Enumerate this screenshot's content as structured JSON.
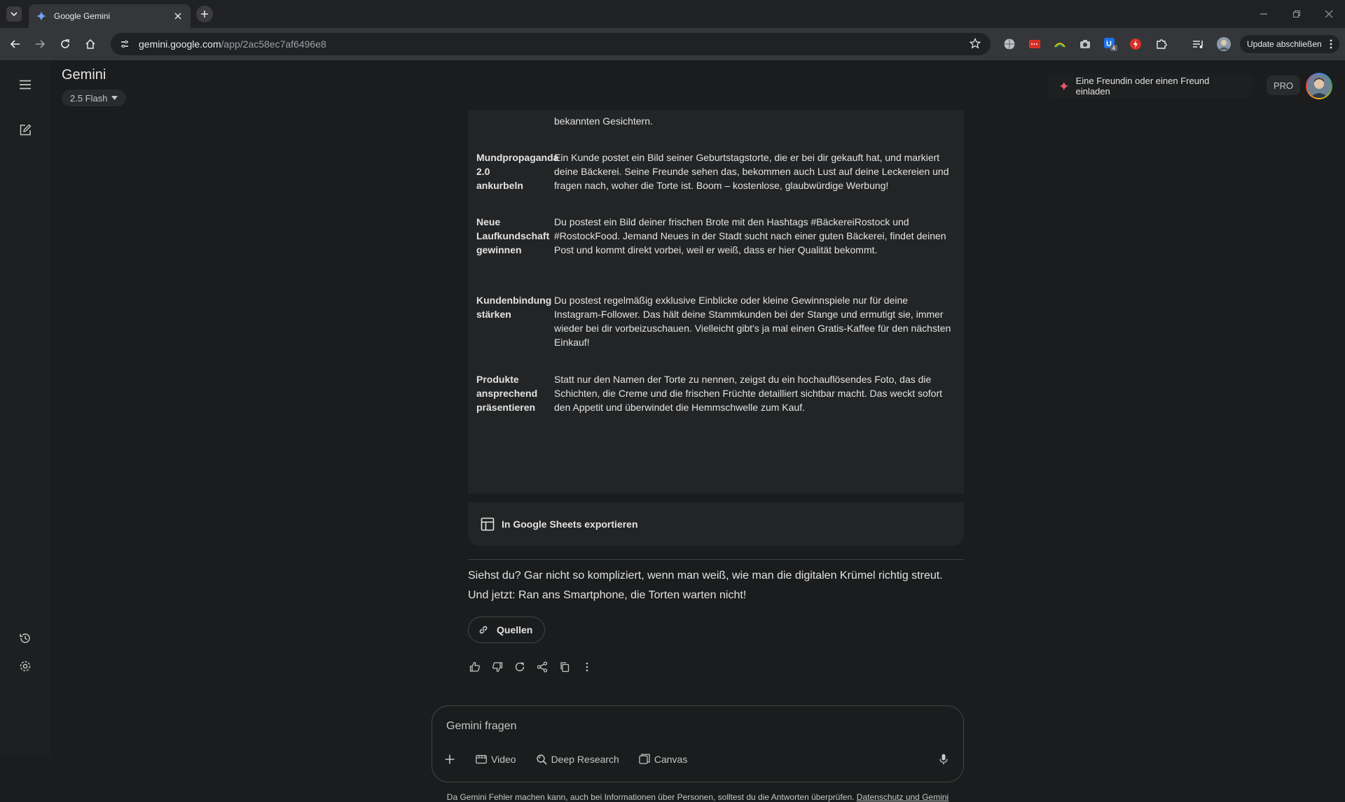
{
  "browser": {
    "tab_title": "Google Gemini",
    "url_host": "gemini.google.com",
    "url_path": "/app/2ac58ec7af6496e8",
    "update_label": "Update abschließen",
    "extension_badge": "4"
  },
  "header": {
    "app_title": "Gemini",
    "model_label": "2.5 Flash",
    "invite_label": "Eine Freundin oder einen Freund einladen",
    "pro_label": "PRO"
  },
  "table": {
    "partial_text": "bekannten Gesichtern.",
    "rows": [
      {
        "key": "Mundpropaganda 2.0 ankurbeln",
        "value": "Ein Kunde postet ein Bild seiner Geburtstagstorte, die er bei dir gekauft hat, und markiert deine Bäckerei. Seine Freunde sehen das, bekommen auch Lust auf deine Leckereien und fragen nach, woher die Torte ist. Boom – kostenlose, glaubwürdige Werbung!"
      },
      {
        "key": "Neue Laufkundschaft gewinnen",
        "value": "Du postest ein Bild deiner frischen Brote mit den Hashtags #BäckereiRostock und #RostockFood. Jemand Neues in der Stadt sucht nach einer guten Bäckerei, findet deinen Post und kommt direkt vorbei, weil er weiß, dass er hier Qualität bekommt."
      },
      {
        "key": "Kundenbindung stärken",
        "value": "Du postest regelmäßig exklusive Einblicke oder kleine Gewinnspiele nur für deine Instagram-Follower. Das hält deine Stammkunden bei der Stange und ermutigt sie, immer wieder bei dir vorbeizuschauen. Vielleicht gibt's ja mal einen Gratis-Kaffee für den nächsten Einkauf!"
      },
      {
        "key": "Produkte ansprechend präsentieren",
        "value": "Statt nur den Namen der Torte zu nennen, zeigst du ein hochauflösendes Foto, das die Schichten, die Creme und die frischen Früchte detailliert sichtbar macht. Das weckt sofort den Appetit und überwindet die Hemmschwelle zum Kauf."
      }
    ],
    "export_label": "In Google Sheets exportieren"
  },
  "response": {
    "closing_text": "Siehst du? Gar nicht so kompliziert, wenn man weiß, wie man die digitalen Krümel richtig streut. Und jetzt: Ran ans Smartphone, die Torten warten nicht!",
    "sources_label": "Quellen"
  },
  "input": {
    "placeholder": "Gemini fragen",
    "tools": [
      "Video",
      "Deep Research",
      "Canvas"
    ]
  },
  "footer": {
    "disclaimer": "Da Gemini Fehler machen kann, auch bei Informationen über Personen, solltest du die Antworten überprüfen.",
    "link_label": "Datenschutz und Gemini"
  },
  "colors": {
    "background": "#1b1c1d",
    "card": "#232425",
    "text": "#e3e3e3",
    "muted": "#c4c7c5",
    "accent_spark": "#e8566b"
  }
}
